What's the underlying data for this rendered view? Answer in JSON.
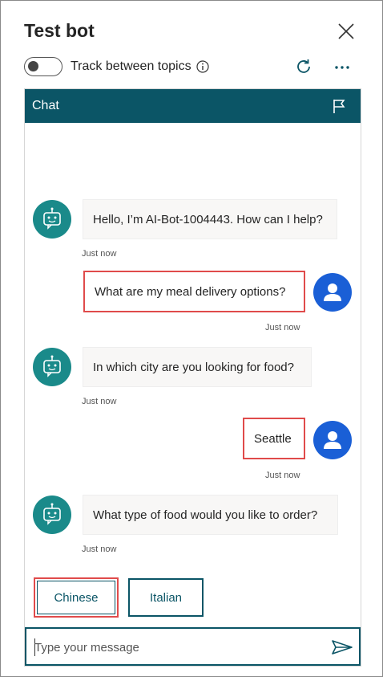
{
  "panel": {
    "title": "Test bot",
    "toggle_label": "Track between topics",
    "toggle_state": "off"
  },
  "chat": {
    "header_title": "Chat",
    "messages": [
      {
        "sender": "bot",
        "text": "Hello, I’m AI-Bot-1004443. How can I help?",
        "timestamp": "Just now"
      },
      {
        "sender": "user",
        "text": "What are my meal delivery options?",
        "timestamp": "Just now"
      },
      {
        "sender": "bot",
        "text": "In which city are you looking for food?",
        "timestamp": "Just now"
      },
      {
        "sender": "user",
        "text": "Seattle",
        "timestamp": "Just now"
      },
      {
        "sender": "bot",
        "text": "What type of food would you like to order?",
        "timestamp": "Just now"
      }
    ],
    "suggested_actions": [
      "Chinese",
      "Italian"
    ],
    "input": {
      "placeholder": "Type your message",
      "value": ""
    }
  },
  "icons": {
    "close": "close-icon",
    "info": "info-icon",
    "refresh": "refresh-icon",
    "more": "more-horizontal-icon",
    "flag": "flag-icon",
    "bot": "bot-icon",
    "user": "user-icon",
    "send": "send-icon"
  },
  "colors": {
    "header_bg": "#0b5566",
    "bot_avatar": "#1a8a8a",
    "user_avatar": "#1a5fd6",
    "highlight": "#e04b4b",
    "accent": "#0b5566"
  }
}
